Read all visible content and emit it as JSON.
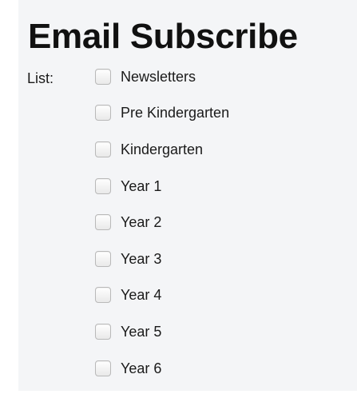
{
  "form": {
    "title": "Email Subscribe",
    "list_label": "List:",
    "options": [
      {
        "label": "Newsletters",
        "checked": false
      },
      {
        "label": "Pre Kindergarten",
        "checked": false
      },
      {
        "label": "Kindergarten",
        "checked": false
      },
      {
        "label": "Year 1",
        "checked": false
      },
      {
        "label": "Year 2",
        "checked": false
      },
      {
        "label": "Year 3",
        "checked": false
      },
      {
        "label": "Year 4",
        "checked": false
      },
      {
        "label": "Year 5",
        "checked": false
      },
      {
        "label": "Year 6",
        "checked": false
      }
    ]
  },
  "colors": {
    "panel_background": "#f4f5f7",
    "text": "#1a1a1a",
    "checkbox_border": "#b9b9b9"
  }
}
